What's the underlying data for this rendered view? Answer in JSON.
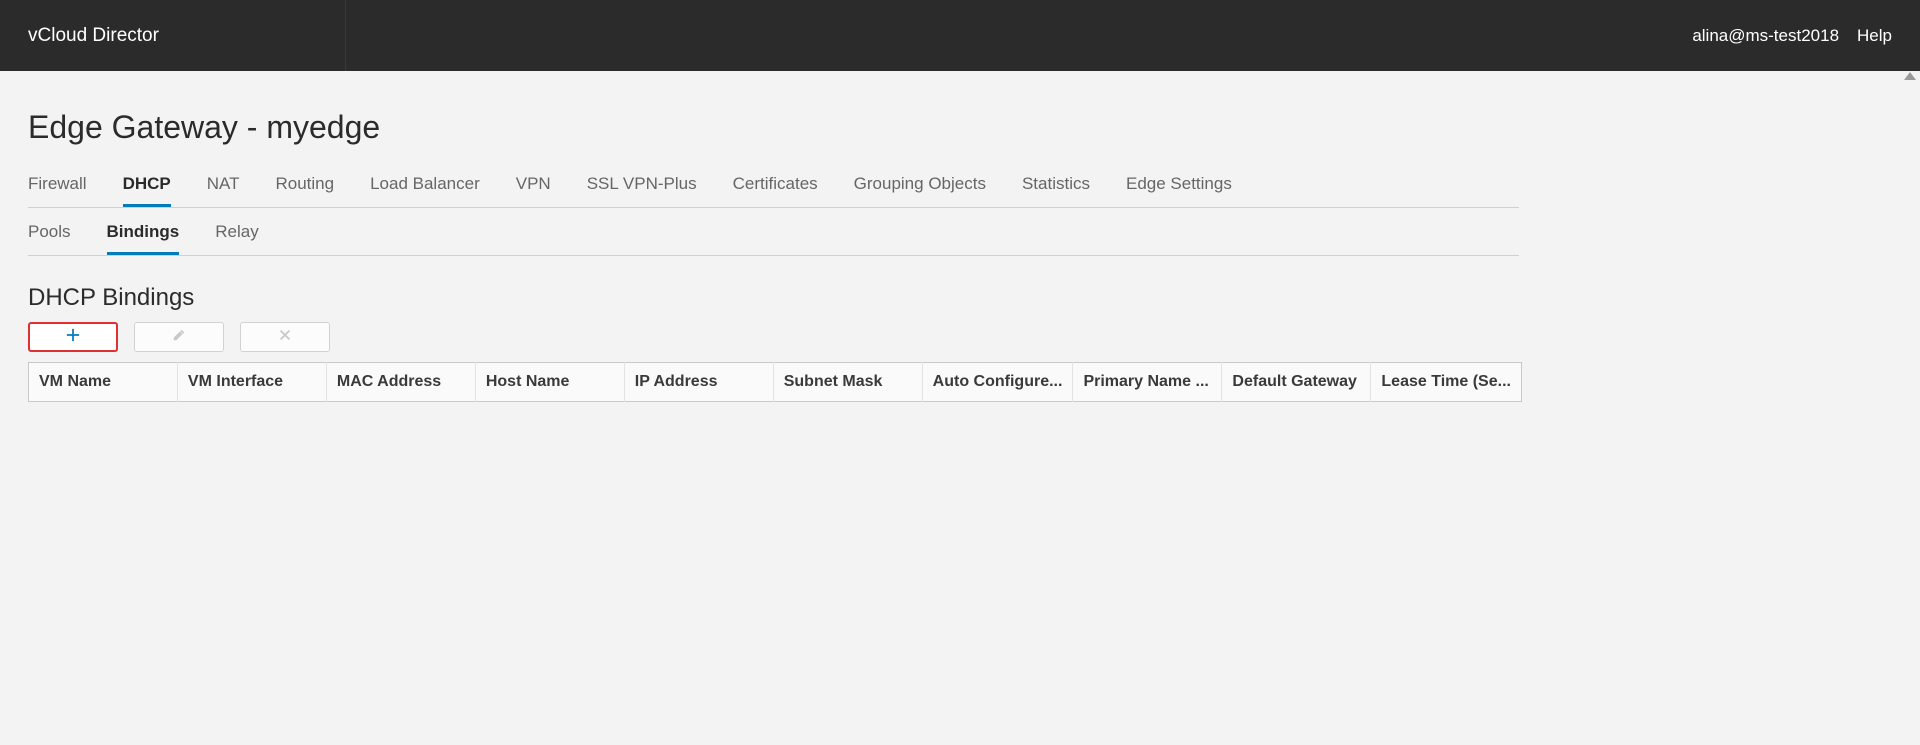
{
  "header": {
    "brand": "vCloud Director",
    "user": "alina@ms-test2018",
    "help": "Help"
  },
  "page": {
    "title": "Edge Gateway - myedge"
  },
  "tabs": [
    {
      "label": "Firewall",
      "active": false
    },
    {
      "label": "DHCP",
      "active": true
    },
    {
      "label": "NAT",
      "active": false
    },
    {
      "label": "Routing",
      "active": false
    },
    {
      "label": "Load Balancer",
      "active": false
    },
    {
      "label": "VPN",
      "active": false
    },
    {
      "label": "SSL VPN-Plus",
      "active": false
    },
    {
      "label": "Certificates",
      "active": false
    },
    {
      "label": "Grouping Objects",
      "active": false
    },
    {
      "label": "Statistics",
      "active": false
    },
    {
      "label": "Edge Settings",
      "active": false
    }
  ],
  "sub_tabs": [
    {
      "label": "Pools",
      "active": false
    },
    {
      "label": "Bindings",
      "active": true
    },
    {
      "label": "Relay",
      "active": false
    }
  ],
  "section": {
    "title": "DHCP Bindings"
  },
  "columns": [
    "VM Name",
    "VM Interface",
    "MAC Address",
    "Host Name",
    "IP Address",
    "Subnet Mask",
    "Auto Configure...",
    "Primary Name ...",
    "Default Gateway",
    "Lease Time (Se..."
  ],
  "rows": []
}
